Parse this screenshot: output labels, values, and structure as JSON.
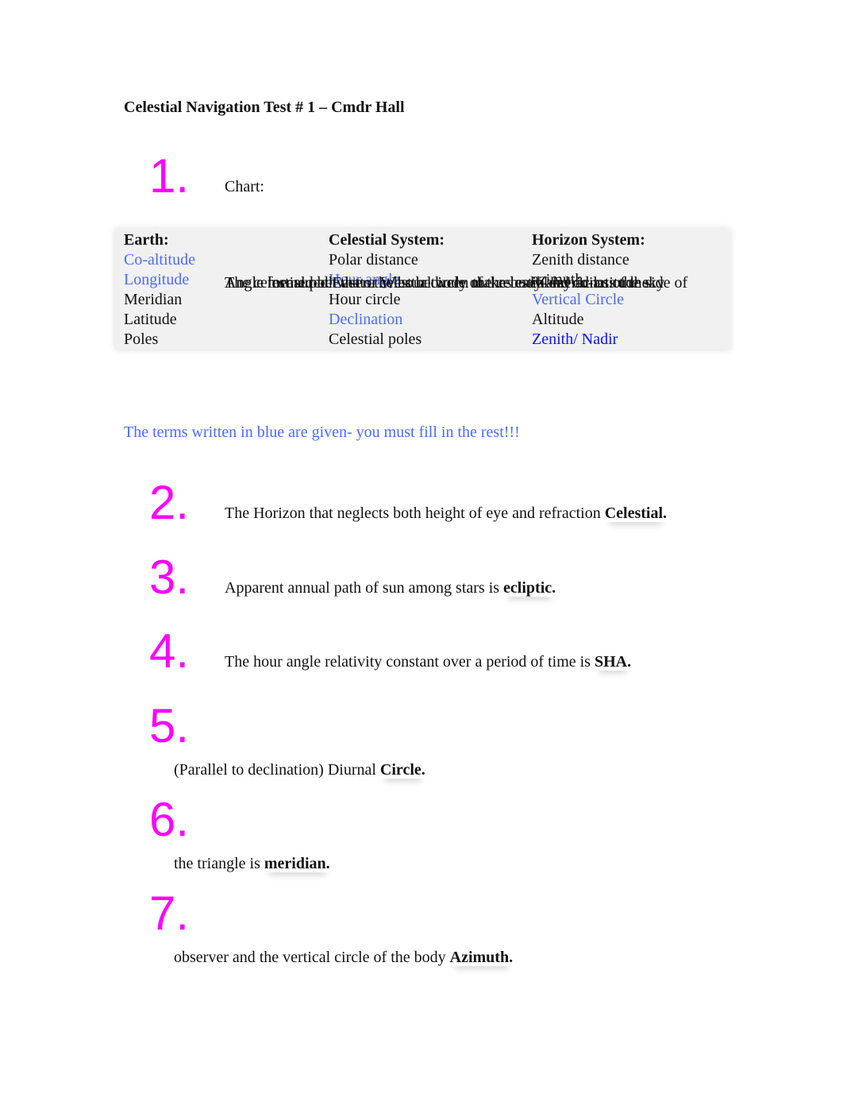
{
  "title": "Celestial Navigation Test # 1 – Cmdr Hall",
  "q1": {
    "number": "1.",
    "text": "Chart:"
  },
  "table": {
    "colors": {
      "given": "#4a6bff",
      "given_dark": "#0a14ff"
    },
    "columns": [
      {
        "header": "Earth:",
        "rows": [
          {
            "text": "Co-altitude",
            "given": true
          },
          {
            "text": "Longitude",
            "given": true
          },
          {
            "text": "Meridian",
            "given": false
          },
          {
            "text": "Latitude",
            "given": false
          },
          {
            "text": "Poles",
            "given": false
          }
        ]
      },
      {
        "header": "Celestial System:",
        "rows": [
          {
            "text": "Polar distance",
            "given": false
          },
          {
            "text": "Hour angle",
            "given": true
          },
          {
            "text": "Hour circle",
            "given": false
          },
          {
            "text": "Declination",
            "given": true
          },
          {
            "text": "Celestial poles",
            "given": false
          }
        ]
      },
      {
        "header": "Horizon System:",
        "rows": [
          {
            "text": "Zenith distance",
            "given": false
          },
          {
            "text": "azimuth",
            "given": false
          },
          {
            "text": "Vertical Circle",
            "given": true
          },
          {
            "text": "Altitude",
            "given": false
          },
          {
            "text": "Zenith/ Nadir",
            "given": true
          }
        ]
      }
    ]
  },
  "note": "The terms written in blue are given- you must fill in the rest!!!",
  "number_color": "#ff00ff",
  "questions": [
    {
      "number": "2.",
      "line1": "The Horizon that neglects both height of eye and refraction ",
      "line2": "",
      "answer": "Celestial."
    },
    {
      "number": "3.",
      "line1": "Apparent annual path of sun among stars is ",
      "line2": "",
      "answer": "ecliptic."
    },
    {
      "number": "4.",
      "line1": "The hour angle relativity constant over a period of time is ",
      "line2": "",
      "answer": "SHA."
    },
    {
      "number": "5.",
      "line1": "The celestial path that a celestial body makes each day across the sky",
      "line2": "(Parallel to declination) Diurnal ",
      "answer": "Circle."
    },
    {
      "number": "6.",
      "line1": "Angle formed between the hour circle of the body and co-latitude side of",
      "line2": "the triangle is ",
      "answer": "meridian."
    },
    {
      "number": "7.",
      "line1": "Angle measured East or West between the celestial meridian of the",
      "line2": "observer and the vertical circle of the body ",
      "answer": "Azimuth."
    }
  ]
}
